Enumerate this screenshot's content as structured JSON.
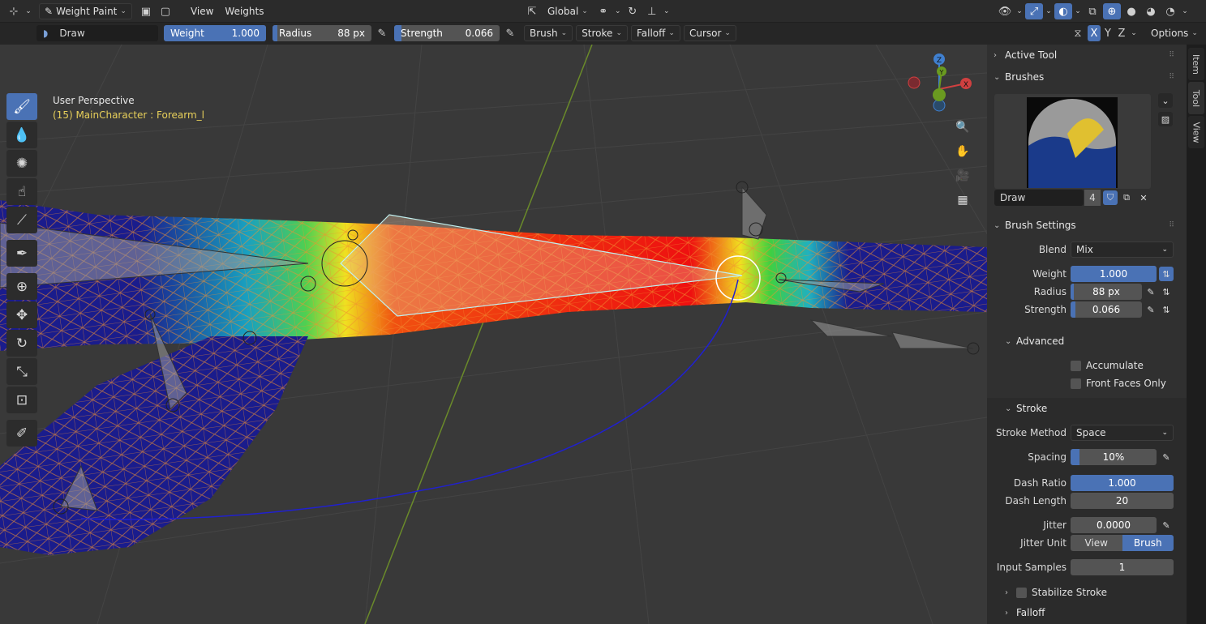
{
  "header": {
    "mode": "Weight Paint",
    "menus": [
      "View",
      "Weights"
    ],
    "transform_orientation": "Global"
  },
  "toolbar": {
    "brush_name": "Draw",
    "weight_label": "Weight",
    "weight_value": "1.000",
    "radius_label": "Radius",
    "radius_value": "88 px",
    "strength_label": "Strength",
    "strength_value": "0.066",
    "menus": [
      "Brush",
      "Stroke",
      "Falloff",
      "Cursor"
    ],
    "axes": [
      "X",
      "Y",
      "Z"
    ],
    "options": "Options"
  },
  "viewport": {
    "perspective": "User Perspective",
    "object_info": "(15) MainCharacter : Forearm_l",
    "gizmo": {
      "x": "X",
      "y": "Y",
      "z": "Z"
    }
  },
  "tools": [
    "draw-tool",
    "blur-tool",
    "average-tool",
    "smear-tool",
    "gradient-tool",
    "sample-weight-tool",
    "cursor-tool",
    "move-tool",
    "rotate-tool",
    "scale-tool",
    "transform-tool",
    "annotate-tool"
  ],
  "sidebar": {
    "tabs": [
      "Item",
      "Tool",
      "View"
    ],
    "active_tab": "Tool",
    "active_tool": "Active Tool",
    "brushes": "Brushes",
    "brush_name": "Draw",
    "brush_users": "4",
    "brush_settings": {
      "title": "Brush Settings",
      "blend_label": "Blend",
      "blend": "Mix",
      "weight_label": "Weight",
      "weight": "1.000",
      "weight_fraction": 1.0,
      "radius_label": "Radius",
      "radius": "88 px",
      "radius_fraction": 0.05,
      "strength_label": "Strength",
      "strength": "0.066",
      "strength_fraction": 0.066
    },
    "advanced": {
      "title": "Advanced",
      "accumulate": "Accumulate",
      "front_faces_only": "Front Faces Only"
    },
    "stroke": {
      "title": "Stroke",
      "method_label": "Stroke Method",
      "method": "Space",
      "spacing_label": "Spacing",
      "spacing": "10%",
      "spacing_fraction": 0.1,
      "dash_ratio_label": "Dash Ratio",
      "dash_ratio": "1.000",
      "dash_ratio_fraction": 1.0,
      "dash_length_label": "Dash Length",
      "dash_length": "20",
      "jitter_label": "Jitter",
      "jitter": "0.0000",
      "jitter_unit_label": "Jitter Unit",
      "jitter_unit_options": [
        "View",
        "Brush"
      ],
      "jitter_unit": "Brush",
      "input_samples_label": "Input Samples",
      "input_samples": "1",
      "stabilize": "Stabilize Stroke"
    },
    "falloff": "Falloff"
  },
  "colors": {
    "accent": "#4a72b5",
    "object_info": "#e8d05a"
  }
}
